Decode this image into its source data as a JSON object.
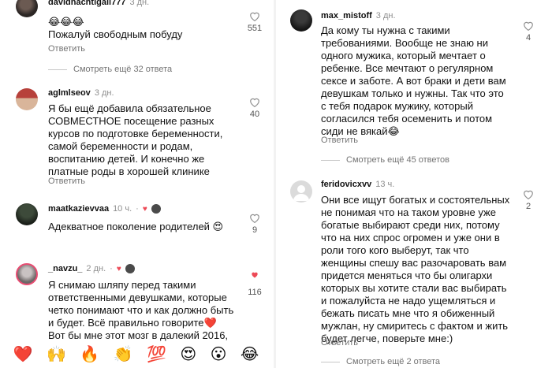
{
  "left": {
    "c1": {
      "user": "davidnachtigall777",
      "time": "3 дн.",
      "text": "😂😂😂\nПожалуй свободным побуду",
      "likes": "551",
      "reply": "Ответить"
    },
    "more1": "Смотреть ещё 32 ответа",
    "c2": {
      "user": "aglmlseov",
      "time": "3 дн.",
      "text": "Я бы ещё добавила обязательное\nСОВМЕСТНОЕ посещение разных\nкурсов по подготовке беременности,\nсамой беременности и родам,\nвоспитанию детей. И конечно же\nплатные роды в хорошей клинике",
      "likes": "40",
      "reply": "Ответить"
    },
    "c3": {
      "user": "maatkazievvaa",
      "time": "10 ч.",
      "text": "Адекватное поколение родителей 😍",
      "likes": "9"
    },
    "c4": {
      "user": "_navzu_",
      "time": "2 дн.",
      "text": "Я снимаю шляпу перед такими\nответственными девушками, которые\nчетко понимают что и как должно быть\nи будет. Всё правильно говорите❤️\nВот бы мне этот мозг в далекий 2016,",
      "likes": "116"
    },
    "emojis": [
      "❤️",
      "🙌",
      "🔥",
      "👏",
      "💯",
      "😍",
      "😮",
      "😂"
    ]
  },
  "right": {
    "c1": {
      "user": "max_mistoff",
      "time": "3 дн.",
      "text": "Да кому ты нужна с такими\nтребованиями. Вообще не знаю ни\nодного мужика, который мечтает о\nребенке. Все мечтают о регулярном\nсексе и заботе. А вот браки и дети вам\nдевушкам только и нужны. Так что это\nс тебя подарок мужику, который\nсогласился тебя осеменить и потом\nсиди не вякай😂",
      "likes": "4",
      "reply": "Ответить"
    },
    "more1": "Смотреть ещё 45 ответов",
    "c2": {
      "user": "feridovicxvv",
      "time": "13 ч.",
      "text": "Они все ищут богатых и состоятельных\nне понимая что на таком уровне уже\nбогатые выбирают среди них, потому\nчто на них спрос огромен и уже они в\nроли того кого выберут, так что\nженщины спешу вас разочаровать вам\nпридется меняться что бы олигархи\nкоторых вы хотите стали вас выбирать\nи пожалуйста не надо ущемляться и\nбежать писать мне что я обиженный\nмужлан, ну смиритесь с фактом и жить\nбудет легче, поверьте мне:)",
      "likes": "2",
      "reply": "Ответить"
    },
    "more2": "Смотреть ещё 2 ответа"
  }
}
